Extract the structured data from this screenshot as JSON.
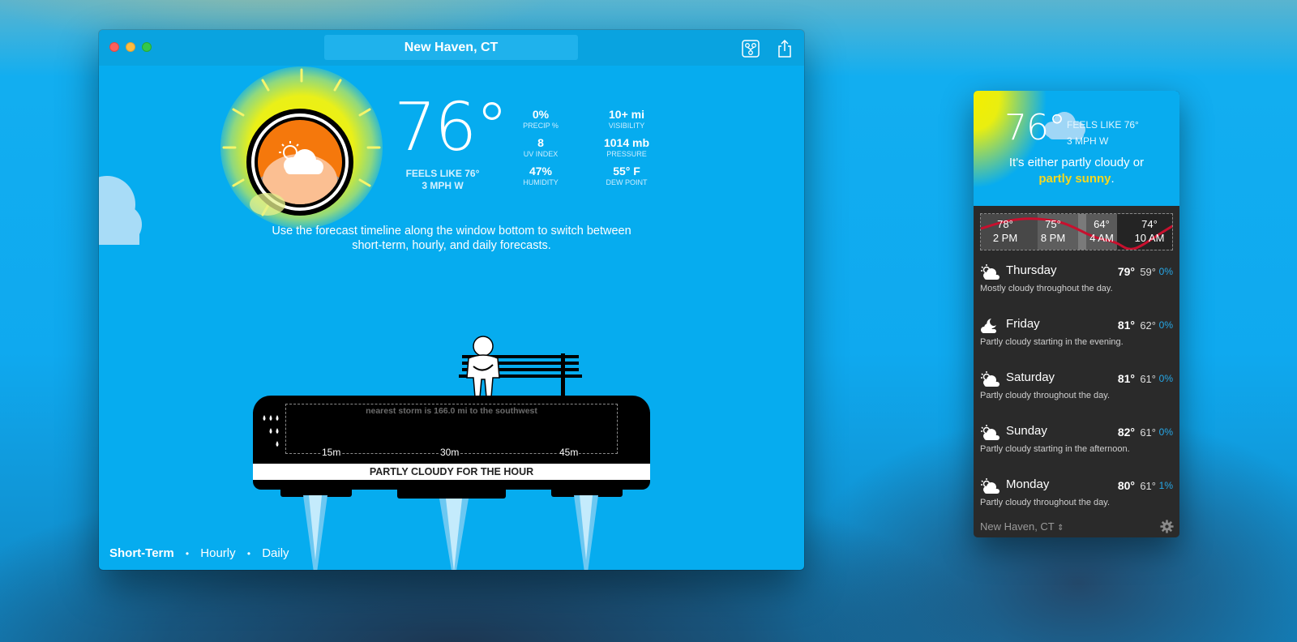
{
  "main_window": {
    "title": "New Haven, CT",
    "toolbar": {
      "connect_icon": "network-share-icon",
      "share_icon": "share-icon"
    },
    "current": {
      "temperature": "76°",
      "feels_like": "FEELS LIKE 76°",
      "wind": "3 MPH W",
      "condition_icon": "partly-cloudy-icon"
    },
    "stats": [
      {
        "value": "0%",
        "label": "PRECIP %"
      },
      {
        "value": "10+ mi",
        "label": "VISIBILITY"
      },
      {
        "value": "8",
        "label": "UV INDEX"
      },
      {
        "value": "1014 mb",
        "label": "PRESSURE"
      },
      {
        "value": "47%",
        "label": "HUMIDITY"
      },
      {
        "value": "55° F",
        "label": "DEW POINT"
      }
    ],
    "tip_line1": "Use the forecast timeline along the window bottom to switch between",
    "tip_line2": "short-term, hourly, and daily forecasts.",
    "precip_chart": {
      "storm_note": "nearest storm is 166.0 mi to the southwest",
      "ticks": [
        "15m",
        "30m",
        "45m"
      ]
    },
    "hour_summary": "PARTLY CLOUDY FOR THE HOUR",
    "timeline": {
      "items": [
        "Short-Term",
        "Hourly",
        "Daily"
      ],
      "active": "Short-Term",
      "separator": "•"
    }
  },
  "widget": {
    "temperature": "76°",
    "feels_like": "FEELS LIKE 76°",
    "wind": "3 MPH W",
    "summary_prefix": "It's either partly cloudy or",
    "summary_highlight": "partly sunny",
    "summary_suffix": ".",
    "highlight_color": "#f5d820",
    "hourly": [
      {
        "temp": "78°",
        "time": "2 PM"
      },
      {
        "temp": "75°",
        "time": "8 PM"
      },
      {
        "temp": "64°",
        "time": "4 AM"
      },
      {
        "temp": "74°",
        "time": "10 AM"
      }
    ],
    "days": [
      {
        "name": "Thursday",
        "hi": "79°",
        "lo": "59°",
        "precip": "0%",
        "desc": "Mostly cloudy throughout the day.",
        "icon": "partly-cloudy-day-icon"
      },
      {
        "name": "Friday",
        "hi": "81°",
        "lo": "62°",
        "precip": "0%",
        "desc": "Partly cloudy starting in the evening.",
        "icon": "partly-cloudy-night-icon"
      },
      {
        "name": "Saturday",
        "hi": "81°",
        "lo": "61°",
        "precip": "0%",
        "desc": "Partly cloudy throughout the day.",
        "icon": "partly-cloudy-day-icon"
      },
      {
        "name": "Sunday",
        "hi": "82°",
        "lo": "61°",
        "precip": "0%",
        "desc": "Partly cloudy starting in the afternoon.",
        "icon": "partly-cloudy-day-icon"
      },
      {
        "name": "Monday",
        "hi": "80°",
        "lo": "61°",
        "precip": "1%",
        "desc": "Partly cloudy throughout the day.",
        "icon": "partly-cloudy-day-icon"
      }
    ],
    "location": "New Haven, CT",
    "location_chevron": "⇕",
    "settings_icon": "gear-icon"
  }
}
